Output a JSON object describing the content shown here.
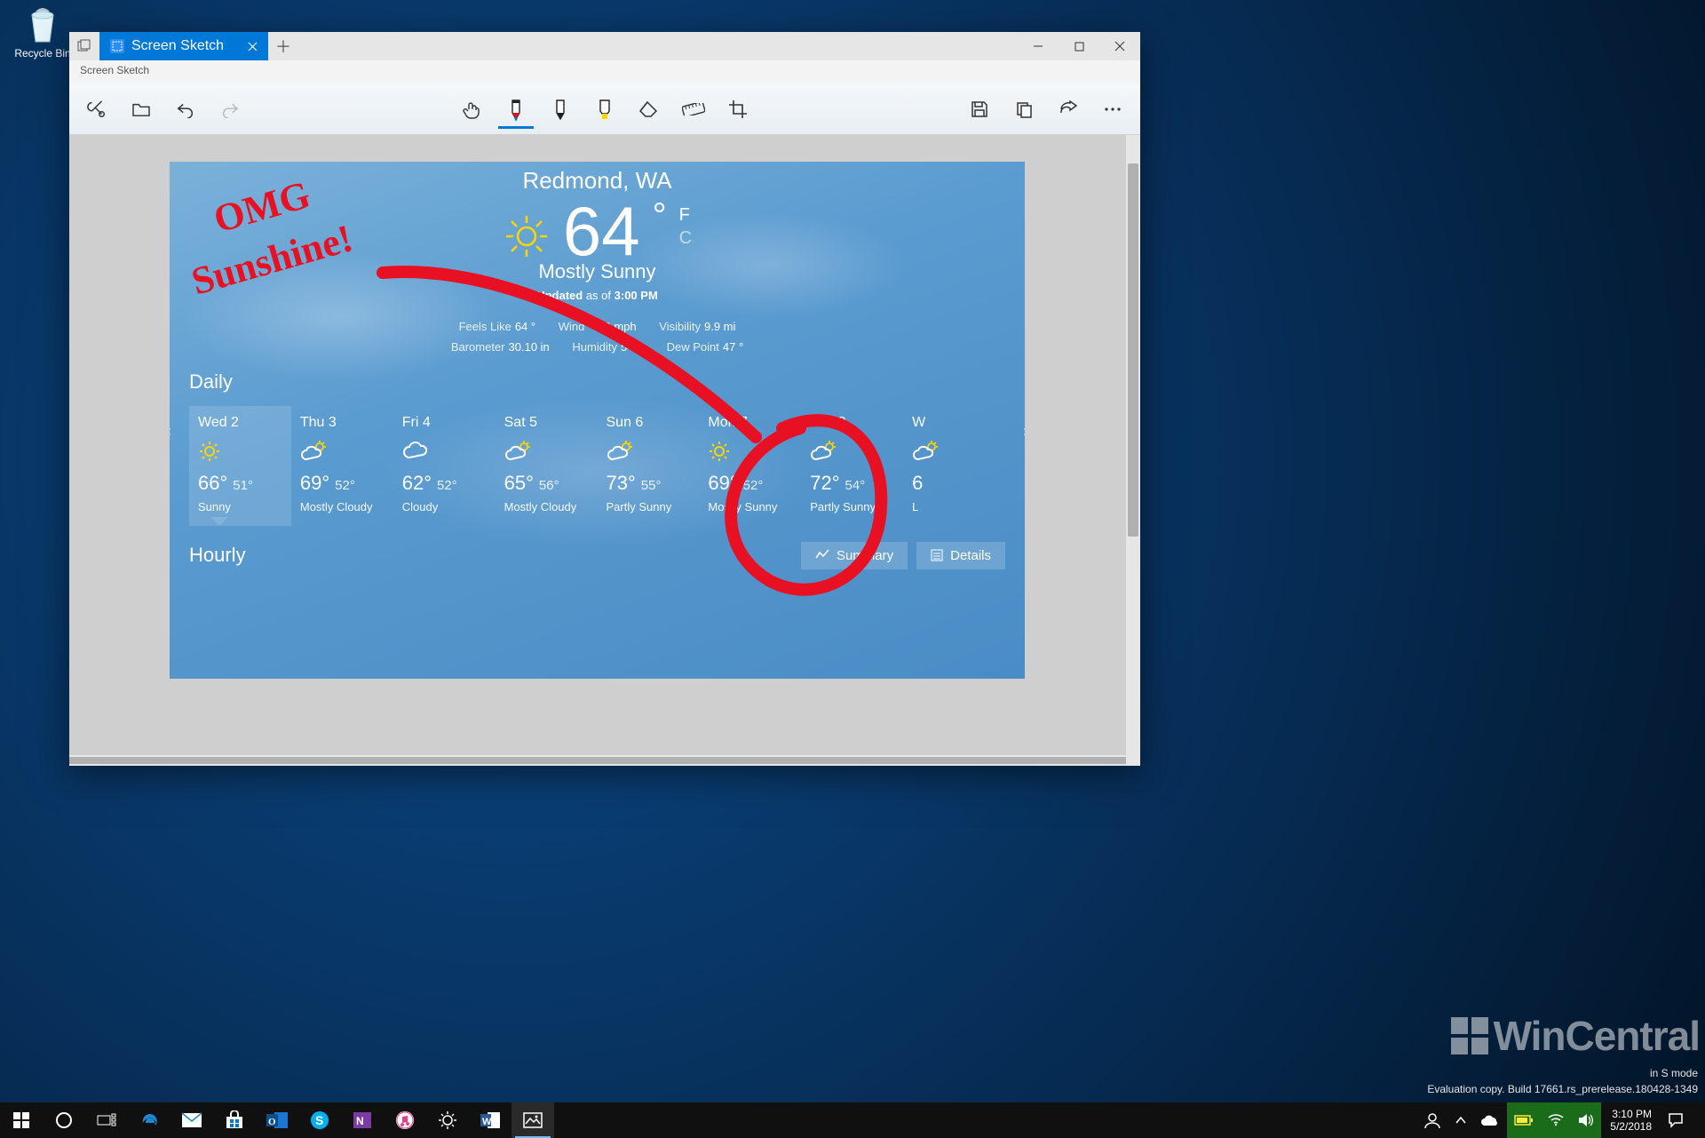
{
  "desktop": {
    "recycle_bin": "Recycle Bin"
  },
  "window": {
    "tab_title": "Screen Sketch",
    "sub_title": "Screen Sketch"
  },
  "toolbar": {
    "snip": "New snip",
    "open": "Open",
    "undo": "Undo",
    "redo": "Redo",
    "touch": "Touch writing",
    "pen_red": "Ballpoint pen",
    "pen_black": "Pencil",
    "highlighter": "Highlighter",
    "eraser": "Eraser",
    "ruler": "Ruler",
    "crop": "Image crop",
    "save": "Save",
    "copy": "Copy",
    "share": "Share",
    "more": "More"
  },
  "weather": {
    "location": "Redmond, WA",
    "temp": "64",
    "unit_f": "F",
    "unit_c": "C",
    "condition": "Mostly Sunny",
    "updated_label": "Updated",
    "updated_time": "3:00 PM",
    "updated_joiner": "as of",
    "feels_like_label": "Feels Like",
    "feels_like": "64 °",
    "wind_label": "Wind",
    "wind": "9 mph",
    "visibility_label": "Visibility",
    "visibility": "9.9 mi",
    "barometer_label": "Barometer",
    "barometer": "30.10 in",
    "humidity_label": "Humidity",
    "humidity": "54%",
    "dew_label": "Dew Point",
    "dew": "47 °",
    "daily_title": "Daily",
    "hourly_title": "Hourly",
    "summary_btn": "Summary",
    "details_btn": "Details",
    "days": [
      {
        "name": "Wed 2",
        "hi": "66°",
        "lo": "51°",
        "cond": "Sunny",
        "icon": "sun"
      },
      {
        "name": "Thu 3",
        "hi": "69°",
        "lo": "52°",
        "cond": "Mostly Cloudy",
        "icon": "cloud-sun"
      },
      {
        "name": "Fri 4",
        "hi": "62°",
        "lo": "52°",
        "cond": "Cloudy",
        "icon": "cloud"
      },
      {
        "name": "Sat 5",
        "hi": "65°",
        "lo": "56°",
        "cond": "Mostly Cloudy",
        "icon": "cloud-sun"
      },
      {
        "name": "Sun 6",
        "hi": "73°",
        "lo": "55°",
        "cond": "Partly Sunny",
        "icon": "cloud-sun"
      },
      {
        "name": "Mon 7",
        "hi": "69°",
        "lo": "52°",
        "cond": "Mostly Sunny",
        "icon": "sun"
      },
      {
        "name": "Tue 8",
        "hi": "72°",
        "lo": "54°",
        "cond": "Partly Sunny",
        "icon": "cloud-sun"
      },
      {
        "name": "W",
        "hi": "6",
        "lo": "",
        "cond": "L",
        "icon": "cloud-sun"
      }
    ]
  },
  "ink_annotation": "OMG Sunshine!",
  "build": {
    "mode": "in S mode",
    "line": "Evaluation copy. Build 17661.rs_prerelease.180428-1349"
  },
  "watermark": "WinCentral",
  "clock": {
    "time": "3:10 PM",
    "date": "5/2/2018"
  }
}
